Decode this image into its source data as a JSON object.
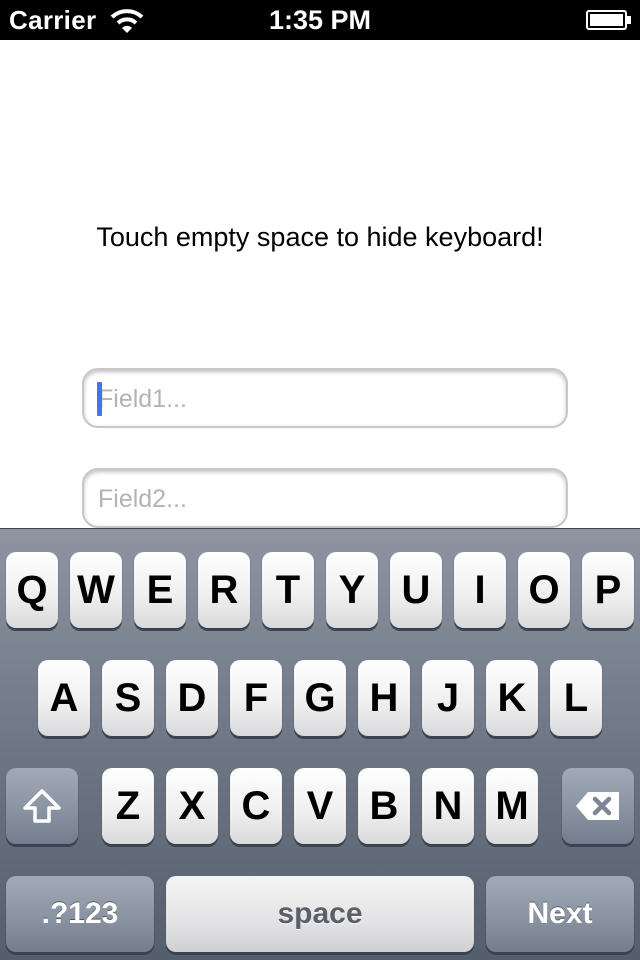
{
  "status_bar": {
    "carrier": "Carrier",
    "time": "1:35 PM",
    "icons": [
      "wifi-icon",
      "battery-icon"
    ]
  },
  "content": {
    "hint": "Touch empty space to hide keyboard!",
    "field1": {
      "value": "",
      "placeholder": "Field1..."
    },
    "field2": {
      "value": "",
      "placeholder": "Field2..."
    }
  },
  "keyboard": {
    "row1": [
      "Q",
      "W",
      "E",
      "R",
      "T",
      "Y",
      "U",
      "I",
      "O",
      "P"
    ],
    "row2": [
      "A",
      "S",
      "D",
      "F",
      "G",
      "H",
      "J",
      "K",
      "L"
    ],
    "row3": [
      "Z",
      "X",
      "C",
      "V",
      "B",
      "N",
      "M"
    ],
    "mode_label": ".?123",
    "space_label": "space",
    "return_label": "Next",
    "icons": [
      "shift-icon",
      "backspace-icon"
    ]
  },
  "colors": {
    "cursor": "#4a72e8",
    "status_bar_bg": "#000000",
    "keyboard_bg": "#6b7483"
  }
}
